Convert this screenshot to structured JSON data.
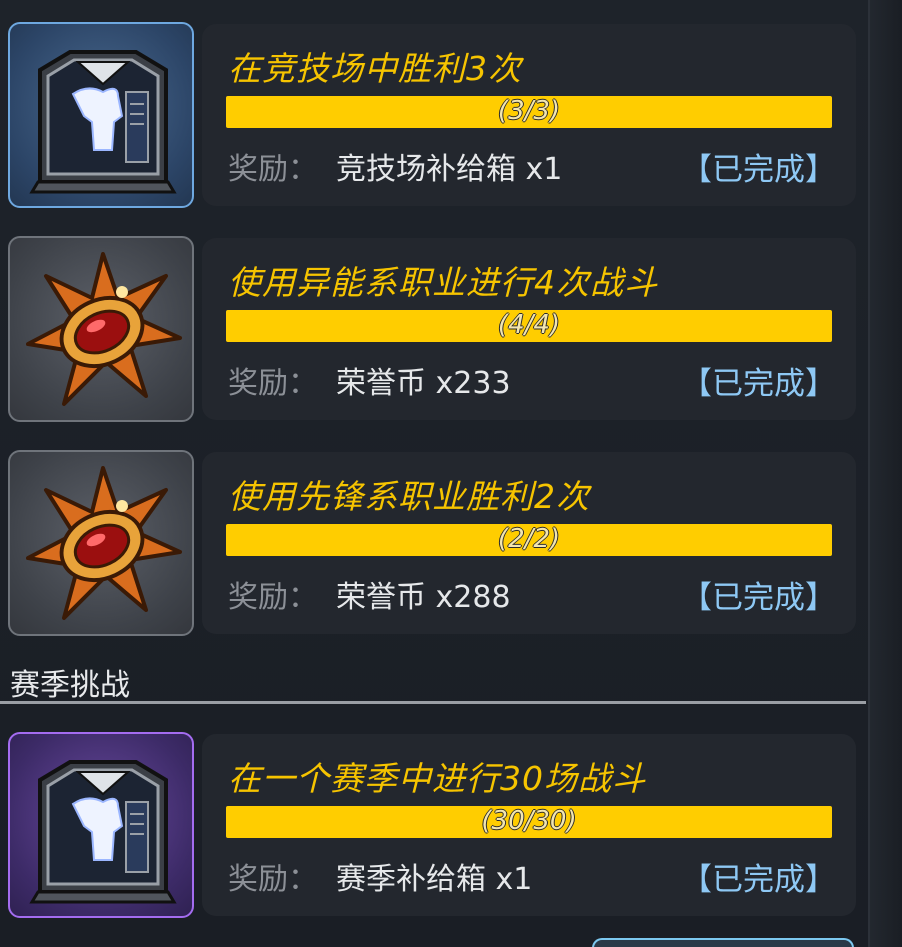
{
  "tasks": [
    {
      "title": "在竞技场中胜利3次",
      "progress_text": "(3/3)",
      "progress_fraction": 1.0,
      "reward_label": "奖励：",
      "reward_value": "竞技场补给箱 x1",
      "status": "【已完成】",
      "icon": "supply-crate-icon",
      "tile_color": "#6ea8e0"
    },
    {
      "title": "使用异能系职业进行4次战斗",
      "progress_text": "(4/4)",
      "progress_fraction": 1.0,
      "reward_label": "奖励：",
      "reward_value": "荣誉币 x233",
      "status": "【已完成】",
      "icon": "honor-coin-icon",
      "tile_color": "#6f747b"
    },
    {
      "title": "使用先锋系职业胜利2次",
      "progress_text": "(2/2)",
      "progress_fraction": 1.0,
      "reward_label": "奖励：",
      "reward_value": "荣誉币 x288",
      "status": "【已完成】",
      "icon": "honor-coin-icon",
      "tile_color": "#6f747b"
    }
  ],
  "season_section": {
    "title": "赛季挑战",
    "tasks": [
      {
        "title": "在一个赛季中进行30场战斗",
        "progress_text": "(30/30)",
        "progress_fraction": 1.0,
        "reward_label": "奖励：",
        "reward_value": "赛季补给箱 x1",
        "status": "【已完成】",
        "icon": "supply-crate-icon",
        "tile_color": "#a46cf0"
      }
    ]
  },
  "colors": {
    "title_yellow": "#f6c400",
    "bar_fill": "#ffcd00",
    "status_blue": "#8ec8f4"
  }
}
